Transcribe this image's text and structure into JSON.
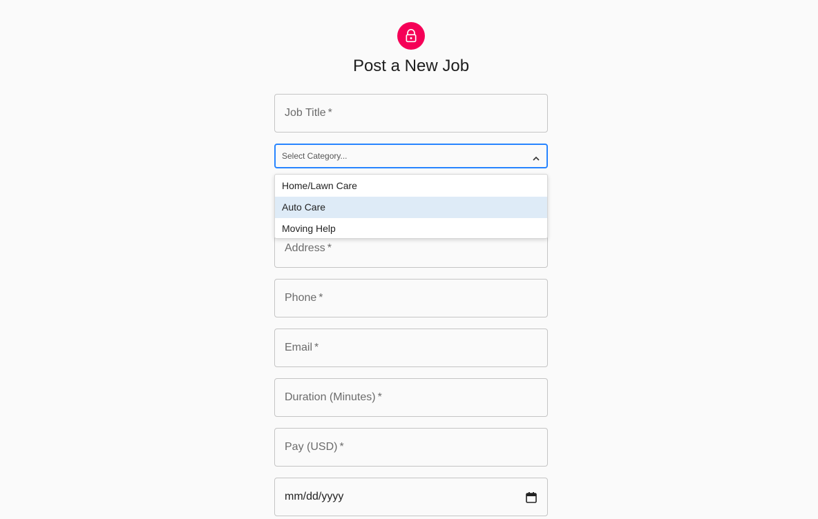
{
  "header": {
    "title": "Post a New Job",
    "avatar_color": "#f50057",
    "avatar_icon": "lock-icon"
  },
  "form": {
    "job_title": {
      "label": "Job Title",
      "required": "*"
    },
    "category": {
      "placeholder": "Select Category...",
      "options": [
        "Home/Lawn Care",
        "Auto Care",
        "Moving Help"
      ],
      "highlighted": "Auto Care",
      "focus_color": "#2684ff"
    },
    "address": {
      "label": "Address",
      "required": "*"
    },
    "phone": {
      "label": "Phone",
      "required": "*"
    },
    "email": {
      "label": "Email",
      "required": "*"
    },
    "duration": {
      "label": "Duration (Minutes)",
      "required": "*"
    },
    "pay": {
      "label": "Pay (USD)",
      "required": "*"
    },
    "date": {
      "placeholder": "mm/dd/yyyy",
      "icon": "calendar-icon"
    }
  }
}
